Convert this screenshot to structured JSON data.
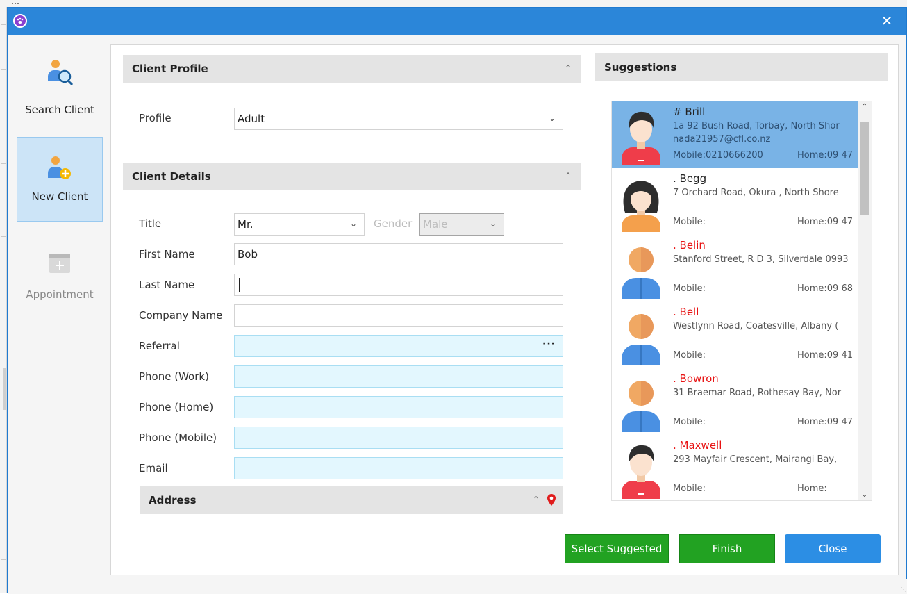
{
  "background": {
    "window_title_fragment": "…"
  },
  "window": {
    "close_glyph": "✕",
    "app_icon_glyph": "❈"
  },
  "nav": {
    "items": [
      {
        "label": "Search Client",
        "icon": "search-client-icon"
      },
      {
        "label": "New Client",
        "icon": "new-client-icon"
      },
      {
        "label": "Appointment",
        "icon": "calendar-add-icon"
      }
    ]
  },
  "client_profile": {
    "header": "Client Profile",
    "profile_label": "Profile",
    "profile_value": "Adult"
  },
  "client_details": {
    "header": "Client Details",
    "title_label": "Title",
    "title_value": "Mr.",
    "gender_label": "Gender",
    "gender_value": "Male",
    "first_name_label": "First Name",
    "first_name_value": "Bob",
    "last_name_label": "Last Name",
    "last_name_value": "",
    "company_label": "Company Name",
    "company_value": "",
    "referral_label": "Referral",
    "referral_button": "···",
    "phone_work_label": "Phone (Work)",
    "phone_home_label": "Phone (Home)",
    "phone_mobile_label": "Phone (Mobile)",
    "email_label": "Email"
  },
  "address": {
    "header": "Address"
  },
  "suggestions": {
    "header": "Suggestions",
    "items": [
      {
        "name": "# Brill",
        "address": "1a 92 Bush Road, Torbay, North Shor",
        "email": "nada21957@cfl.co.nz",
        "mobile": "Mobile:0210666200",
        "home": "Home:09 47",
        "avatar": "male-avatar-icon",
        "selected": true,
        "highlight_name": false
      },
      {
        "name": ". Begg",
        "address": "7 Orchard Road, Okura , North Shore",
        "email": "",
        "mobile": "Mobile:",
        "home": "Home:09 47",
        "avatar": "female-avatar-icon",
        "selected": false,
        "highlight_name": false
      },
      {
        "name": ". Belin",
        "address": "Stanford Street, R D 3, Silverdale 0993",
        "email": "",
        "mobile": "Mobile:",
        "home": "Home:09 68",
        "avatar": "generic-avatar-icon",
        "selected": false,
        "highlight_name": true
      },
      {
        "name": ". Bell",
        "address": "Westlynn Road, Coatesville, Albany (",
        "email": "",
        "mobile": "Mobile:",
        "home": "Home:09 41",
        "avatar": "generic-avatar-icon",
        "selected": false,
        "highlight_name": true
      },
      {
        "name": ". Bowron",
        "address": "31 Braemar Road, Rothesay Bay, Nor",
        "email": "",
        "mobile": "Mobile:",
        "home": "Home:09 47",
        "avatar": "generic-avatar-icon",
        "selected": false,
        "highlight_name": true
      },
      {
        "name": ". Maxwell",
        "address": "293 Mayfair Crescent, Mairangi Bay,",
        "email": "",
        "mobile": "Mobile:",
        "home": "Home:",
        "avatar": "male-avatar-icon",
        "selected": false,
        "highlight_name": true
      }
    ]
  },
  "buttons": {
    "select_suggested": "Select Suggested",
    "finish": "Finish",
    "close": "Close"
  },
  "colors": {
    "titlebar": "#2b86d9",
    "selected_row": "#79b3e6",
    "green_button": "#22a222",
    "blue_button": "#2c8ee4",
    "field_blue": "#e3f7fe",
    "highlight_name": "#e81212"
  }
}
